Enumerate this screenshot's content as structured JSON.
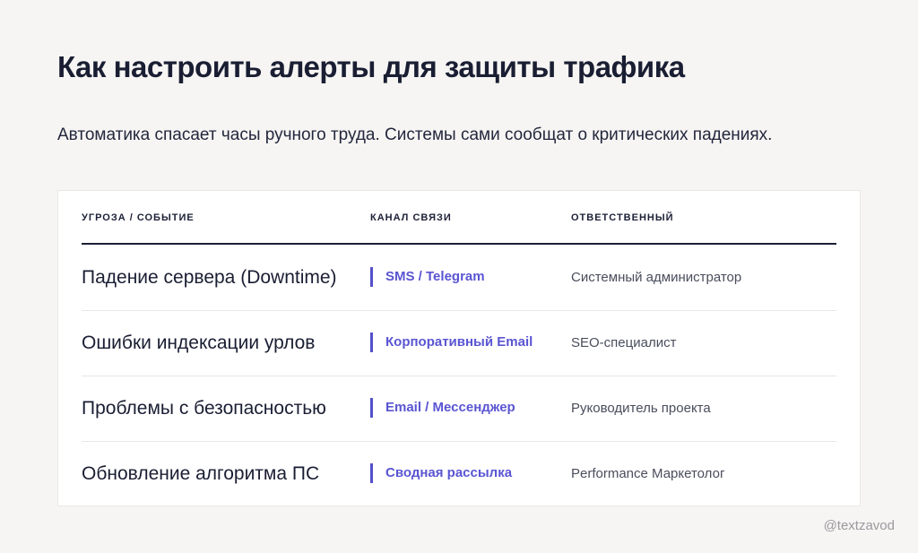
{
  "title": "Как настроить алерты для защиты трафика",
  "subtitle": "Автоматика спасает часы ручного труда. Системы сами сообщат о критических падениях.",
  "table": {
    "headers": {
      "threat": "УГРОЗА / СОБЫТИЕ",
      "channel": "КАНАЛ СВЯЗИ",
      "owner": "ОТВЕТСТВЕННЫЙ"
    },
    "rows": [
      {
        "threat": "Падение сервера (Downtime)",
        "channel": "SMS / Telegram",
        "owner": "Системный администратор"
      },
      {
        "threat": "Ошибки индексации урлов",
        "channel": "Корпоративный Email",
        "owner": "SEO-специалист"
      },
      {
        "threat": "Проблемы с безопасностью",
        "channel": "Email / Мессенджер",
        "owner": "Руководитель проекта"
      },
      {
        "threat": "Обновление алгоритма ПС",
        "channel": "Сводная рассылка",
        "owner": "Performance Маркетолог"
      }
    ]
  },
  "watermark": "@textzavod",
  "colors": {
    "background": "#f6f5f3",
    "text": "#1c2036",
    "accent": "#5a55d2"
  }
}
